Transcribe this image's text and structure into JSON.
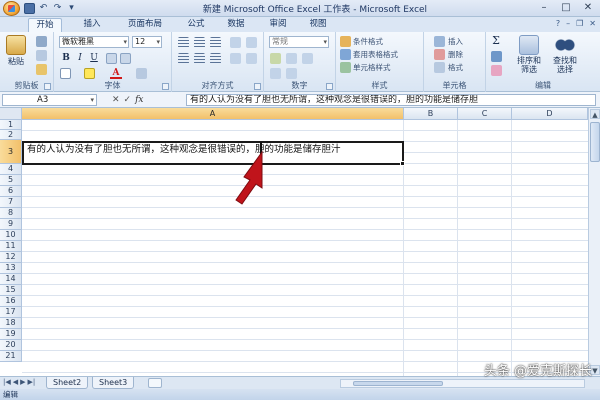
{
  "app": {
    "title": "新建 Microsoft Office Excel 工作表 - Microsoft Excel"
  },
  "tabs": [
    "开始",
    "插入",
    "页面布局",
    "公式",
    "数据",
    "审阅",
    "视图"
  ],
  "ribbon": {
    "clipboard": {
      "paste_label": "粘贴",
      "group_label": "剪贴板"
    },
    "font": {
      "font_name": "微软雅黑",
      "font_size": "12",
      "group_label": "字体",
      "bold": "B",
      "italic": "I",
      "underline": "U"
    },
    "alignment": {
      "group_label": "对齐方式"
    },
    "number": {
      "format": "常规",
      "group_label": "数字"
    },
    "styles": {
      "conditional": "条件格式",
      "table_format": "套用表格格式",
      "cell_styles": "单元格样式",
      "group_label": "样式"
    },
    "cells": {
      "insert": "插入",
      "delete": "删除",
      "format": "格式",
      "group_label": "单元格"
    },
    "editing": {
      "sort_filter": "排序和筛选",
      "find_select": "查找和选择",
      "group_label": "编辑"
    }
  },
  "formula_bar": {
    "name_box": "A3",
    "fx": "fx",
    "content": "有的人认为没有了胆也无所谓，这种观念是很错误的，胆的功能是储存胆"
  },
  "grid": {
    "columns": [
      "A",
      "B",
      "C",
      "D"
    ],
    "rows": [
      "1",
      "2",
      "3",
      "4",
      "5",
      "6",
      "7",
      "8",
      "9",
      "10",
      "11",
      "12",
      "13",
      "14",
      "15",
      "16",
      "17",
      "18",
      "19",
      "20",
      "21"
    ],
    "selected_cell": "A3",
    "a3_text": "有的人认为没有了胆也无所谓，这种观念是很错误的，胆的功能是储存胆汁"
  },
  "sheets": [
    "Sheet2",
    "Sheet3"
  ],
  "status": "编辑",
  "watermark": "头条 @爱克斯探长",
  "colors": {
    "ribbon": "#dbe6f4",
    "selection": "#f2c06a",
    "arrow": "#c0141b"
  }
}
